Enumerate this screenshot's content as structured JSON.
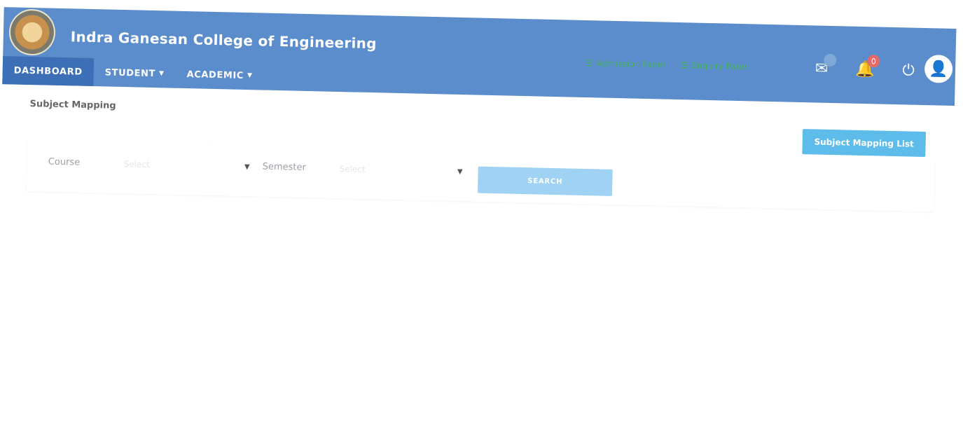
{
  "header": {
    "title": "Indra Ganesan College of Engineering",
    "logo_icon": "college-emblem",
    "links": [
      {
        "icon": "list-icon",
        "label": "Admission Panel"
      },
      {
        "icon": "list-icon",
        "label": "Enquiry Panel"
      }
    ],
    "message_icon": "envelope-icon",
    "notification_icon": "bell-icon",
    "notification_count": "0",
    "power_icon": "power-icon",
    "avatar_icon": "user-avatar"
  },
  "nav": {
    "items": [
      {
        "label": "DASHBOARD",
        "active": true,
        "dropdown": false
      },
      {
        "label": "STUDENT",
        "active": false,
        "dropdown": true
      },
      {
        "label": "ACADEMIC",
        "active": false,
        "dropdown": true
      }
    ]
  },
  "page": {
    "title": "Subject Mapping",
    "list_button": "Subject Mapping List",
    "filters": {
      "course_label": "Course",
      "course_placeholder": "Select",
      "semester_label": "Semester",
      "semester_placeholder": "Select",
      "search_button": "SEARCH"
    }
  },
  "colors": {
    "header_bg": "#5b8ccc",
    "nav_active_bg": "#3c6fb5",
    "link_green": "#47b55b",
    "list_button_bg": "#5dbce9",
    "search_button_bg": "#9fd2f3"
  }
}
